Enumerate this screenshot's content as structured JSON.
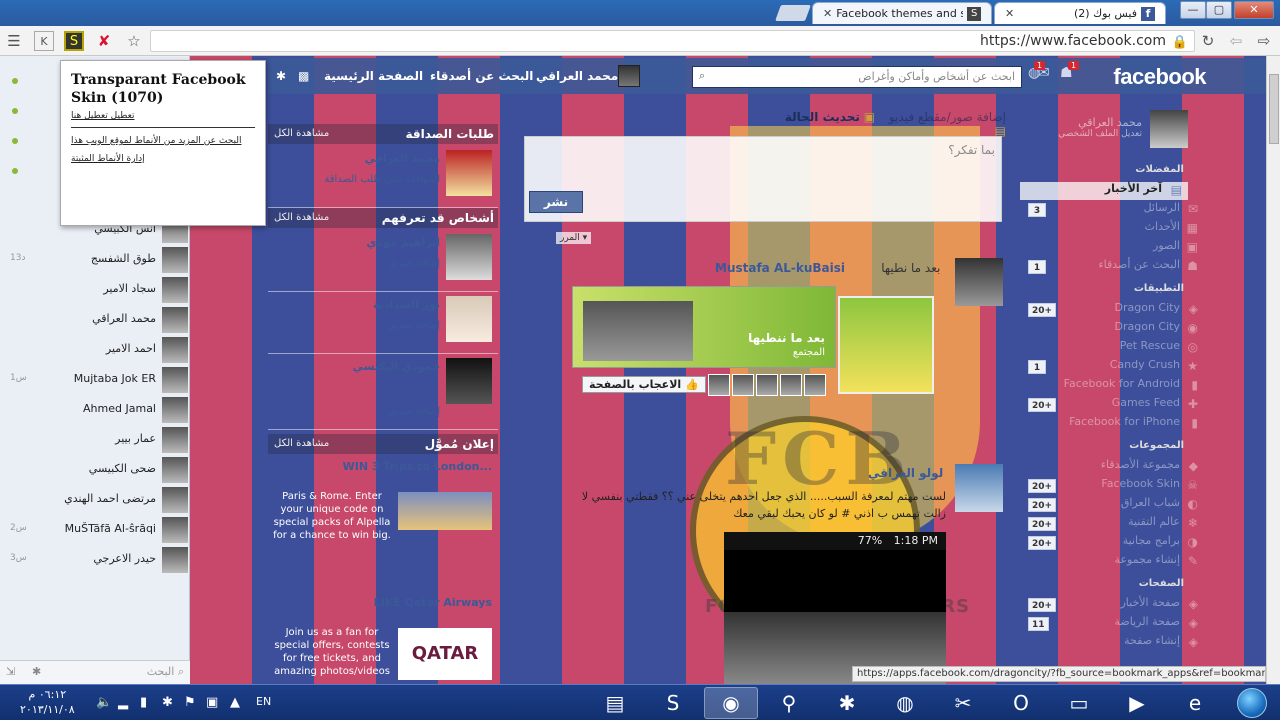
{
  "browser": {
    "tabs": [
      {
        "label": "Facebook themes and ski",
        "active": false
      },
      {
        "label": "(2) فيس بوك",
        "active": true
      }
    ],
    "url": "https://www.facebook.com",
    "window_buttons": {
      "minimize": "—",
      "maximize": "▢",
      "close": "✕"
    }
  },
  "extension_popup": {
    "title": "Transparant Facebook Skin (1070)",
    "disable_link": "تعطيل تعطيل هنا",
    "links": [
      "البحث عن المزيد من الأنماط لموقع الويب هذا",
      "إدارة الأنماط المثبتة"
    ]
  },
  "fb_header": {
    "logo": "facebook",
    "search_placeholder": "ابحث عن أشخاص وأماكن وأغراض",
    "nav": [
      "الصفحة الرئيسية",
      "البحث عن أصدقاء",
      "محمد العراقي"
    ],
    "badges": [
      "1",
      "1"
    ]
  },
  "profile_sidebar": {
    "name": "محمد العراقي",
    "sub": "تعديل الملف الشخصي",
    "sections": [
      {
        "head": "المفضلات",
        "items": [
          {
            "label": "آخر الأخبار",
            "icon": "▤",
            "count": "",
            "active": true
          },
          {
            "label": "الرسائل",
            "icon": "✉",
            "count": "3"
          },
          {
            "label": "الأحداث",
            "icon": "▦",
            "count": ""
          },
          {
            "label": "الصور",
            "icon": "▣",
            "count": ""
          },
          {
            "label": "البحث عن أصدقاء",
            "icon": "☗",
            "count": "1"
          }
        ]
      },
      {
        "head": "التطبيقات",
        "items": [
          {
            "label": "Dragon City",
            "icon": "◈",
            "count": "20+"
          },
          {
            "label": "Dragon City",
            "icon": "◉",
            "count": ""
          },
          {
            "label": "Pet Rescue",
            "icon": "◎",
            "count": ""
          },
          {
            "label": "Candy Crush",
            "icon": "★",
            "count": "1"
          },
          {
            "label": "Facebook for Android",
            "icon": "▮",
            "count": ""
          },
          {
            "label": "Games Feed",
            "icon": "✚",
            "count": "20+"
          },
          {
            "label": "Facebook for iPhone",
            "icon": "▮",
            "count": ""
          }
        ]
      },
      {
        "head": "المجموعات",
        "items": [
          {
            "label": "مجموعة الأصدقاء",
            "icon": "◆",
            "count": ""
          },
          {
            "label": "Facebook Skin",
            "icon": "☠",
            "count": "20+"
          },
          {
            "label": "شباب العراق",
            "icon": "◐",
            "count": "20+"
          },
          {
            "label": "عالم التقنية",
            "icon": "❄",
            "count": "20+"
          },
          {
            "label": "برامج مجانية",
            "icon": "◑",
            "count": "20+"
          },
          {
            "label": "إنشاء مجموعة",
            "icon": "✎",
            "count": ""
          }
        ]
      },
      {
        "head": "الصفحات",
        "items": [
          {
            "label": "صفحة الأخبار",
            "icon": "◈",
            "count": "20+"
          },
          {
            "label": "صفحة الرياضة",
            "icon": "◈",
            "count": "11"
          },
          {
            "label": "إنشاء صفحة",
            "icon": "◈",
            "count": ""
          }
        ]
      }
    ]
  },
  "composer": {
    "tabs": [
      "تحديث الحالة",
      "إضافة صور/مقطع فيديو"
    ],
    "placeholder": "بما تفكر؟",
    "post_button": "نشر",
    "sort_label": "المرر ▾"
  },
  "stories": [
    {
      "author": "Mustafa AL-kuBaisi",
      "verb": "بعد ما نطيها",
      "shared_title": "بعد ما ننطيها",
      "shared_sub": "المجتمع",
      "like_page": "الاعجاب بالصفحة"
    },
    {
      "author": "لولو العراقي",
      "text": "لست مهتم لمعرفة السبب..... الذي جعل احدهم يتخلى عني ؟؟ فقطتي بنفسي لا زالت تهمس ب اذني # لو كان يحبك لبقي معك",
      "phone_time": "1:18 PM",
      "phone_battery": "77%"
    }
  ],
  "middle_column": {
    "friend_requests": {
      "title": "طلبات الصداقة",
      "see_all": "مشاهدة الكل",
      "people": [
        {
          "name": "محمد العراقي",
          "action": "الموافقة على طلب الصداقة"
        }
      ]
    },
    "people_you_may_know": {
      "title": "أشخاص قد تعرفهم",
      "see_all": "مشاهدة الكل",
      "people": [
        {
          "name": "ابراهيم مهدي",
          "action": "إضافة صديق"
        },
        {
          "name": "نور الشدادية",
          "action": "إضافة صديق"
        },
        {
          "name": "حمودي البكيسي",
          "action": "إضافة صديق"
        }
      ]
    },
    "sponsored": {
      "title": "إعلان مُموَّل",
      "see_all": "مشاهدة الكل",
      "ads": [
        {
          "title": "WIN 3 Trips to London...",
          "text": "Paris & Rome. Enter your unique code on special packs of Alpella for a chance to win big."
        },
        {
          "title": "LIKE Qatar Airways",
          "text": "Join us as a fan for special offers, contests for free tickets, and amazing photos/videos",
          "brand": "QATAR"
        }
      ]
    }
  },
  "chat": {
    "contacts": [
      {
        "name": "أنس الكبيسي",
        "time": "",
        "online": true
      },
      {
        "name": "طوق الشفسج",
        "time": "13د",
        "online": false
      },
      {
        "name": "سجاد الامير",
        "time": "",
        "online": false
      },
      {
        "name": "محمد العراقي",
        "time": "",
        "online": false
      },
      {
        "name": "احمد الامير",
        "time": "",
        "online": false
      },
      {
        "name": "Mujtaba Jok ER",
        "time": "1س",
        "online": false
      },
      {
        "name": "Ahmed Jamal",
        "time": "",
        "online": false
      },
      {
        "name": "عمار بيير",
        "time": "",
        "online": false
      },
      {
        "name": "ضحى الكبيسي",
        "time": "",
        "online": false
      },
      {
        "name": "مرتضى احمد الهندي",
        "time": "",
        "online": false
      },
      {
        "name": "MuŠTãfã Al-ŝrãqi",
        "time": "2س",
        "online": false
      },
      {
        "name": "حيدر الاعرجي",
        "time": "3س",
        "online": false
      }
    ],
    "search_placeholder": "البحث"
  },
  "status_url": "https://apps.facebook.com/dragoncity/?fb_source=bookmark_apps&ref=bookmark...",
  "taskbar": {
    "time": "٠٦:١٢ م",
    "date": "٢٠١٣/١١/٠٨",
    "language": "EN",
    "apps": [
      {
        "name": "notepad-app",
        "glyph": "▤",
        "active": false
      },
      {
        "name": "skype-app",
        "glyph": "S",
        "active": false
      },
      {
        "name": "chrome-app",
        "glyph": "◉",
        "active": true
      },
      {
        "name": "tool-app",
        "glyph": "⚲",
        "active": false
      },
      {
        "name": "media-app",
        "glyph": "✱",
        "active": false
      },
      {
        "name": "firefox-app",
        "glyph": "◍",
        "active": false
      },
      {
        "name": "paint-app",
        "glyph": "✂",
        "active": false
      },
      {
        "name": "opera-app",
        "glyph": "O",
        "active": false
      },
      {
        "name": "explorer-folder-app",
        "glyph": "▭",
        "active": false
      },
      {
        "name": "player-app",
        "glyph": "▶",
        "active": false
      },
      {
        "name": "ie-app",
        "glyph": "e",
        "active": false
      }
    ]
  }
}
